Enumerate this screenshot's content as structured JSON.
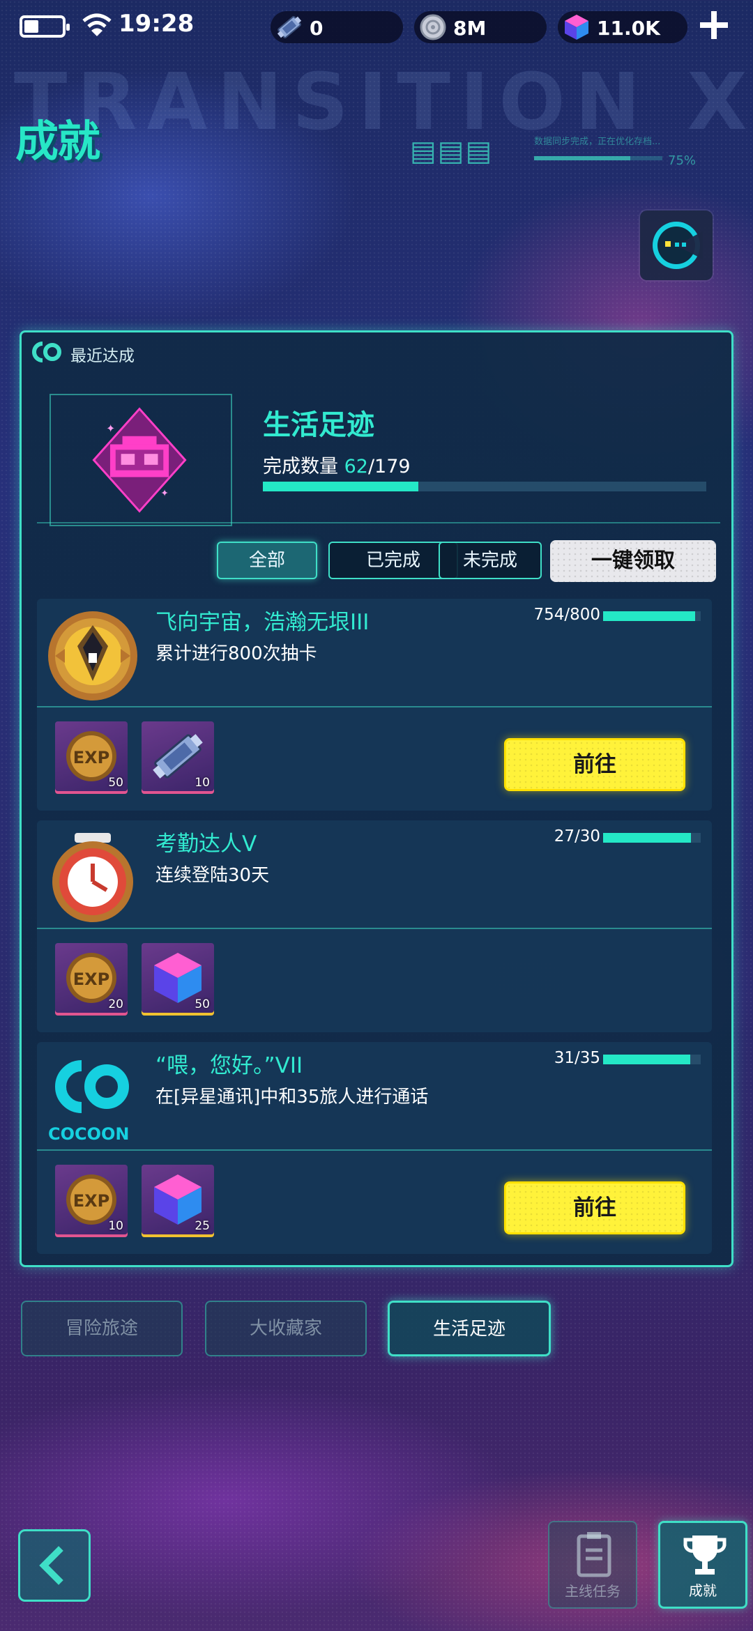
{
  "status_bar": {
    "time": "19:28"
  },
  "currencies": [
    {
      "icon": "ticket-icon",
      "value": "0"
    },
    {
      "icon": "disc-coin-icon",
      "value": "8M"
    },
    {
      "icon": "cube-gem-icon",
      "value": "11.0K"
    }
  ],
  "header": {
    "title": "成就",
    "deco_glyphs": "▤▤▤",
    "deco_text": "数据同步完成，正在优化存档...",
    "deco_percent": "75%",
    "deco_progress": 0.75,
    "bg_word": "TRANSITION XXX"
  },
  "panel": {
    "header_label": "最近达成",
    "category_title": "生活足迹",
    "count_label": "完成数量",
    "completed": "62",
    "total": "/179",
    "progress": 0.35,
    "filters": [
      "全部",
      "已完成",
      "未完成"
    ],
    "claim_all": "一键领取"
  },
  "achievements": [
    {
      "title": "飞向宇宙，浩瀚无垠III",
      "desc": "累计进行800次抽卡",
      "progress_text": "754/800",
      "progress": 0.94,
      "rewards": [
        {
          "icon": "exp-coin-icon",
          "qty": "50"
        },
        {
          "icon": "ticket-icon",
          "qty": "10"
        }
      ],
      "action": "前往"
    },
    {
      "title": "考勤达人V",
      "desc": "连续登陆30天",
      "progress_text": "27/30",
      "progress": 0.9,
      "rewards": [
        {
          "icon": "exp-coin-icon",
          "qty": "20"
        },
        {
          "icon": "cube-gem-icon",
          "qty": "50"
        }
      ]
    },
    {
      "title": "“喂，您好。”VII",
      "desc": "在[异星通讯]中和35旅人进行通话",
      "progress_text": "31/35",
      "progress": 0.89,
      "badge_text": "COCOON",
      "rewards": [
        {
          "icon": "exp-coin-icon",
          "qty": "10"
        },
        {
          "icon": "cube-gem-icon",
          "qty": "25"
        }
      ],
      "action": "前往"
    }
  ],
  "category_tabs": [
    "冒险旅途",
    "大收藏家",
    "生活足迹"
  ],
  "bottom_nav": {
    "quest_label": "主线任务",
    "achievement_label": "成就"
  },
  "colors": {
    "accent": "#3fdfc7",
    "title_teal": "#32ead0",
    "go_button": "#fff23a",
    "card_bg": "#163758"
  }
}
